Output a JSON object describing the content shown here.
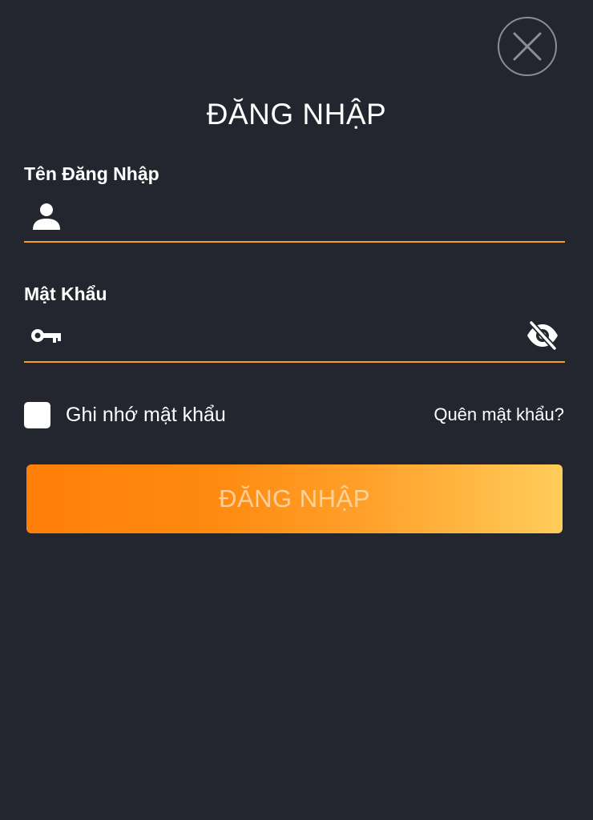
{
  "header": {
    "title": "ĐĂNG NHẬP",
    "close_icon": "close-icon"
  },
  "username": {
    "label": "Tên Đăng Nhập",
    "value": "",
    "placeholder": "",
    "icon": "user-icon"
  },
  "password": {
    "label": "Mật Khẩu",
    "value": "",
    "placeholder": "",
    "icon": "key-icon",
    "toggle_icon": "eye-off-icon"
  },
  "options": {
    "remember_label": "Ghi nhớ mật khẩu",
    "remember_checked": false,
    "forgot_label": "Quên mật khẩu?"
  },
  "submit": {
    "label": "ĐĂNG NHẬP"
  },
  "colors": {
    "background": "#23262e",
    "accent_underline": "#f4a21e",
    "button_gradient_start": "#ff7f0a",
    "button_gradient_end": "#ffcd5a"
  }
}
